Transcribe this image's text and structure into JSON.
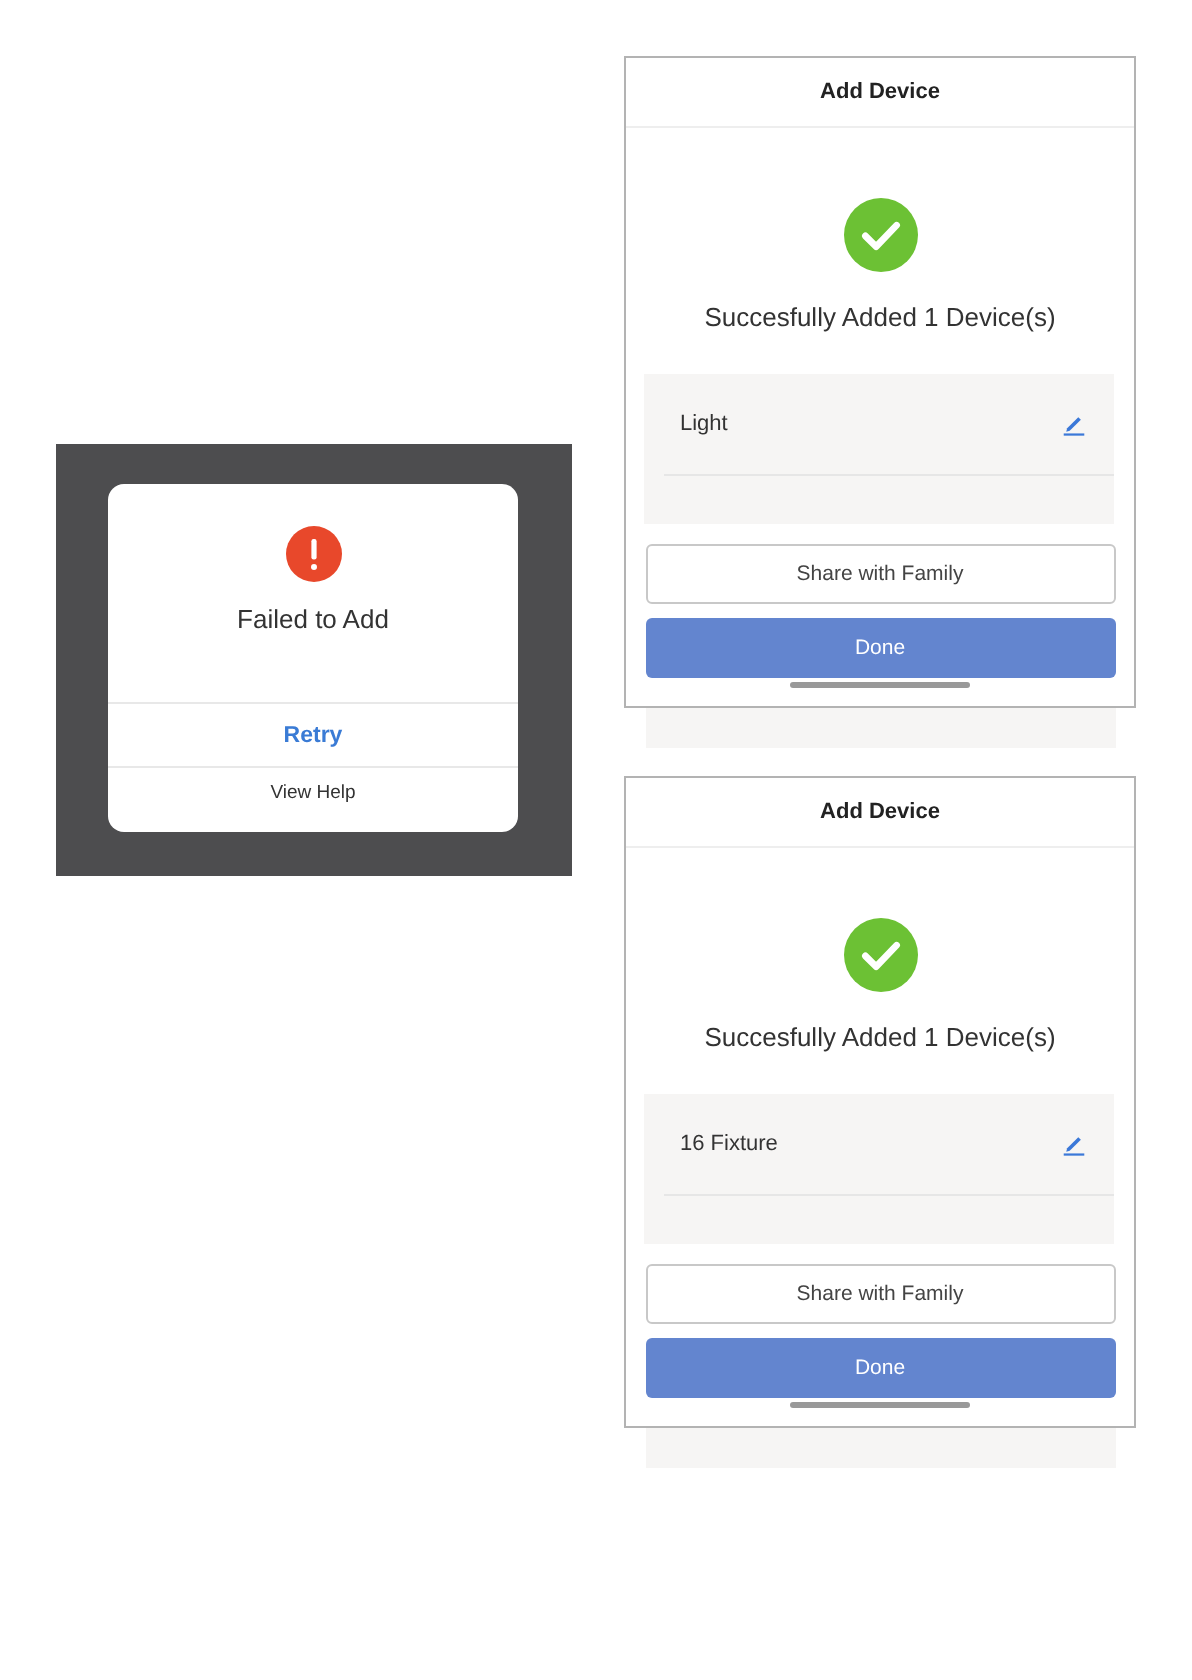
{
  "failure_dialog": {
    "title": "Failed to Add",
    "actions": [
      {
        "label": "Retry",
        "kind": "primary"
      },
      {
        "label": "View Help",
        "kind": "secondary"
      }
    ]
  },
  "screens": [
    {
      "title": "Add Device",
      "message": "Succesfully Added 1 Device(s)",
      "devices": [
        {
          "name": "Light"
        }
      ],
      "buttons": [
        {
          "label": "Share with Family",
          "kind": "outline"
        },
        {
          "label": "Done",
          "kind": "filled"
        }
      ]
    },
    {
      "title": "Add Device",
      "message": "Succesfully Added 1 Device(s)",
      "devices": [
        {
          "name": "16 Fixture"
        }
      ],
      "buttons": [
        {
          "label": "Share with Family",
          "kind": "outline"
        },
        {
          "label": "Done",
          "kind": "filled"
        }
      ]
    }
  ]
}
